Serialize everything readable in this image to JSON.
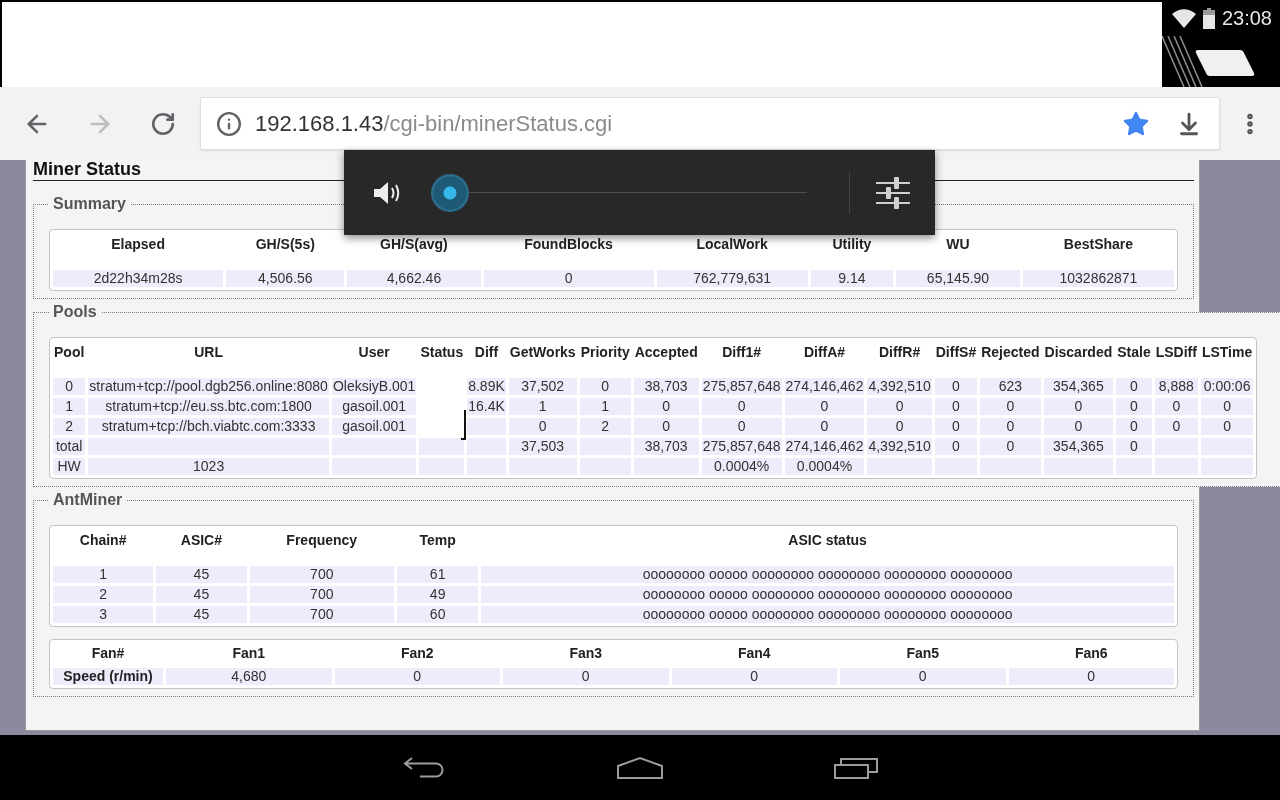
{
  "status_bar": {
    "time": "23:08"
  },
  "toolbar": {
    "forward_button": {
      "disabled": true
    },
    "url": {
      "host": "192.168.1.43",
      "path": "/cgi-bin/minerStatus.cgi"
    },
    "bookmarked": true
  },
  "page": {
    "title": "Miner Status",
    "summary": {
      "legend": "Summary",
      "columns": [
        "Elapsed",
        "GH/S(5s)",
        "GH/S(avg)",
        "FoundBlocks",
        "LocalWork",
        "Utility",
        "WU",
        "BestShare"
      ],
      "rows": [
        [
          "2d22h34m28s",
          "4,506.56",
          "4,662.46",
          "0",
          "762,779,631",
          "9.14",
          "65,145.90",
          "1032862871"
        ]
      ]
    },
    "pools": {
      "legend": "Pools",
      "columns": [
        "Pool",
        "URL",
        "User",
        "Status",
        "Diff",
        "GetWorks",
        "Priority",
        "Accepted",
        "Diff1#",
        "DiffA#",
        "DiffR#",
        "DiffS#",
        "Rejected",
        "Discarded",
        "Stale",
        "LSDiff",
        "LSTime"
      ],
      "rows": [
        {
          "kind": "pool",
          "cells": [
            "0",
            "stratum+tcp://pool.dgb256.online:8080",
            "OleksiyB.001",
            null,
            "8.89K",
            "37,502",
            "0",
            "38,703",
            "275,857,648",
            "274,146,462",
            "4,392,510",
            "0",
            "623",
            "354,365",
            "0",
            "8,888",
            "0:00:06"
          ]
        },
        {
          "kind": "pool",
          "cells": [
            "1",
            "stratum+tcp://eu.ss.btc.com:1800",
            "gasoil.001",
            null,
            "16.4K",
            "1",
            "1",
            "0",
            "0",
            "0",
            "0",
            "0",
            "0",
            "0",
            "0",
            "0",
            "0"
          ]
        },
        {
          "kind": "pool",
          "cells": [
            "2",
            "stratum+tcp://bch.viabtc.com:3333",
            "gasoil.001",
            null,
            null,
            "0",
            "2",
            "0",
            "0",
            "0",
            "0",
            "0",
            "0",
            "0",
            "0",
            "0",
            "0"
          ]
        },
        {
          "kind": "summary",
          "cells": [
            "total",
            null,
            null,
            null,
            null,
            "37,503",
            null,
            "38,703",
            "275,857,648",
            "274,146,462",
            "4,392,510",
            "0",
            "0",
            "354,365",
            "0",
            null,
            null
          ]
        },
        {
          "kind": "summary",
          "cells": [
            "HW",
            "1023",
            null,
            null,
            null,
            null,
            null,
            null,
            "0.0004%",
            "0.0004%",
            null,
            null,
            null,
            null,
            null,
            null,
            null
          ]
        }
      ]
    },
    "antminer": {
      "legend": "AntMiner",
      "chains": {
        "columns": [
          "Chain#",
          "ASIC#",
          "Frequency",
          "Temp",
          "ASIC status"
        ],
        "rows": [
          [
            "1",
            "45",
            "700",
            "61",
            "oooooooo ooooo oooooooo oooooooo oooooooo oooooooo"
          ],
          [
            "2",
            "45",
            "700",
            "49",
            "oooooooo ooooo oooooooo oooooooo oooooooo oooooooo"
          ],
          [
            "3",
            "45",
            "700",
            "60",
            "oooooooo ooooo oooooooo oooooooo oooooooo oooooooo"
          ]
        ]
      },
      "fans": {
        "columns": [
          "Fan#",
          "Fan1",
          "Fan2",
          "Fan3",
          "Fan4",
          "Fan5",
          "Fan6"
        ],
        "rows": [
          [
            "Speed (r/min)",
            "4,680",
            "0",
            "0",
            "0",
            "0",
            "0"
          ]
        ]
      }
    }
  },
  "volume_popup": {
    "level": 0
  }
}
